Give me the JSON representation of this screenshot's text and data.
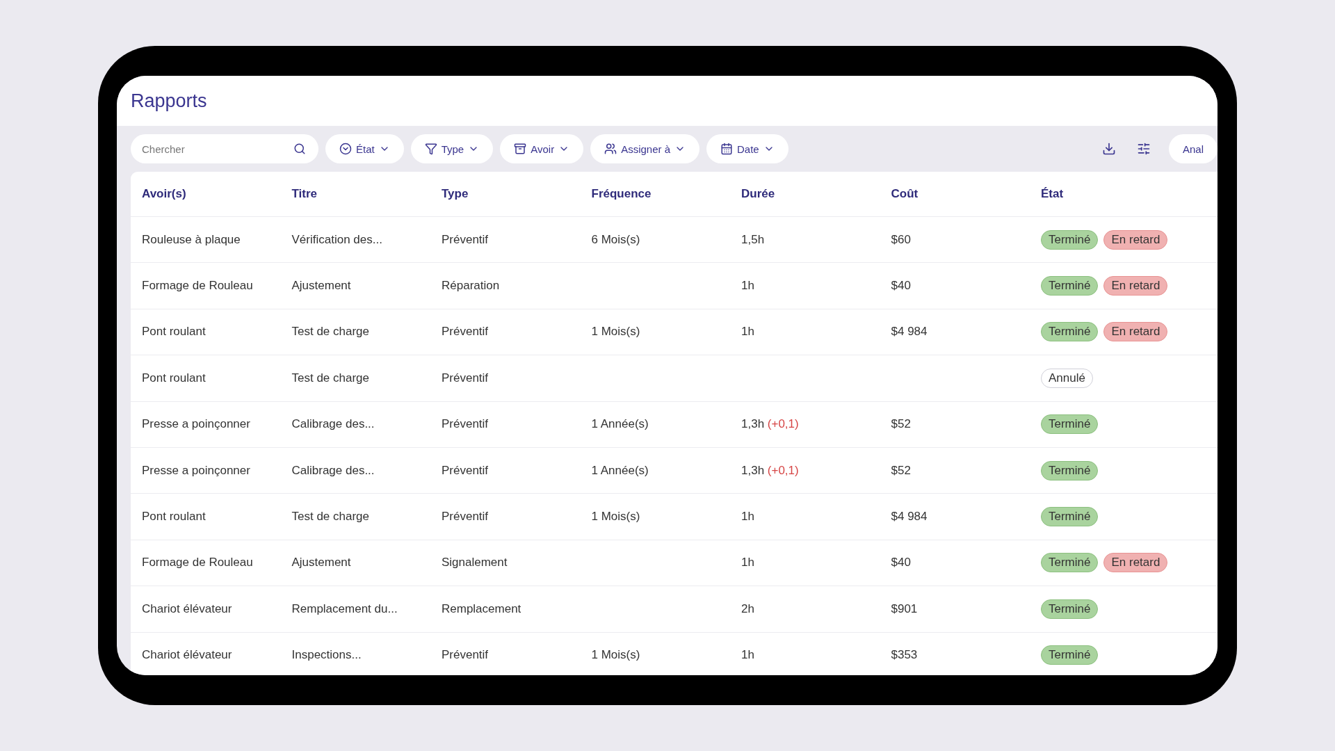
{
  "page": {
    "title": "Rapports"
  },
  "toolbar": {
    "search": {
      "placeholder": "Chercher"
    },
    "filters": [
      {
        "kind": "state",
        "label": "État"
      },
      {
        "kind": "type",
        "label": "Type"
      },
      {
        "kind": "asset",
        "label": "Avoir"
      },
      {
        "kind": "assignee",
        "label": "Assigner à"
      },
      {
        "kind": "date",
        "label": "Date"
      }
    ],
    "analytics_button": "Anal"
  },
  "table": {
    "columns": [
      "Avoir(s)",
      "Titre",
      "Type",
      "Fréquence",
      "Durée",
      "Coût",
      "État"
    ],
    "rows": [
      {
        "asset": "Rouleuse à plaque",
        "title": "Vérification des...",
        "type": "Préventif",
        "frequency": "6 Mois(s)",
        "duration": "1,5h",
        "cost": "$60",
        "states": [
          {
            "kind": "done",
            "label": "Terminé"
          },
          {
            "kind": "late",
            "label": "En retard"
          }
        ]
      },
      {
        "asset": "Formage de Rouleau",
        "title": "Ajustement",
        "type": "Réparation",
        "duration": "1h",
        "cost": "$40",
        "states": [
          {
            "kind": "done",
            "label": "Terminé"
          },
          {
            "kind": "late",
            "label": "En retard"
          }
        ]
      },
      {
        "asset": "Pont roulant",
        "title": "Test de charge",
        "type": "Préventif",
        "frequency": "1 Mois(s)",
        "duration": "1h",
        "cost": "$4 984",
        "states": [
          {
            "kind": "done",
            "label": "Terminé"
          },
          {
            "kind": "late",
            "label": "En retard"
          }
        ]
      },
      {
        "asset": "Pont roulant",
        "title": "Test de charge",
        "type": "Préventif",
        "states": [
          {
            "kind": "cancelled",
            "label": "Annulé"
          }
        ]
      },
      {
        "asset": "Presse a poinçonner",
        "title": "Calibrage des...",
        "type": "Préventif",
        "frequency": "1 Année(s)",
        "duration": "1,3h",
        "duration_delta": "(+0,1)",
        "cost": "$52",
        "states": [
          {
            "kind": "done",
            "label": "Terminé"
          }
        ]
      },
      {
        "asset": "Presse a poinçonner",
        "title": "Calibrage des...",
        "type": "Préventif",
        "frequency": "1 Année(s)",
        "duration": "1,3h",
        "duration_delta": "(+0,1)",
        "cost": "$52",
        "states": [
          {
            "kind": "done",
            "label": "Terminé"
          }
        ]
      },
      {
        "asset": "Pont roulant",
        "title": "Test de charge",
        "type": "Préventif",
        "frequency": "1 Mois(s)",
        "duration": "1h",
        "cost": "$4 984",
        "states": [
          {
            "kind": "done",
            "label": "Terminé"
          }
        ]
      },
      {
        "asset": "Formage de Rouleau",
        "title": "Ajustement",
        "type": "Signalement",
        "duration": "1h",
        "cost": "$40",
        "states": [
          {
            "kind": "done",
            "label": "Terminé"
          },
          {
            "kind": "late",
            "label": "En retard"
          }
        ]
      },
      {
        "asset": "Chariot élévateur",
        "title": "Remplacement du...",
        "type": "Remplacement",
        "duration": "2h",
        "cost": "$901",
        "states": [
          {
            "kind": "done",
            "label": "Terminé"
          }
        ]
      },
      {
        "asset": "Chariot élévateur",
        "title": "Inspections...",
        "type": "Préventif",
        "frequency": "1 Mois(s)",
        "duration": "1h",
        "cost": "$353",
        "states": [
          {
            "kind": "done",
            "label": "Terminé"
          }
        ]
      }
    ]
  }
}
